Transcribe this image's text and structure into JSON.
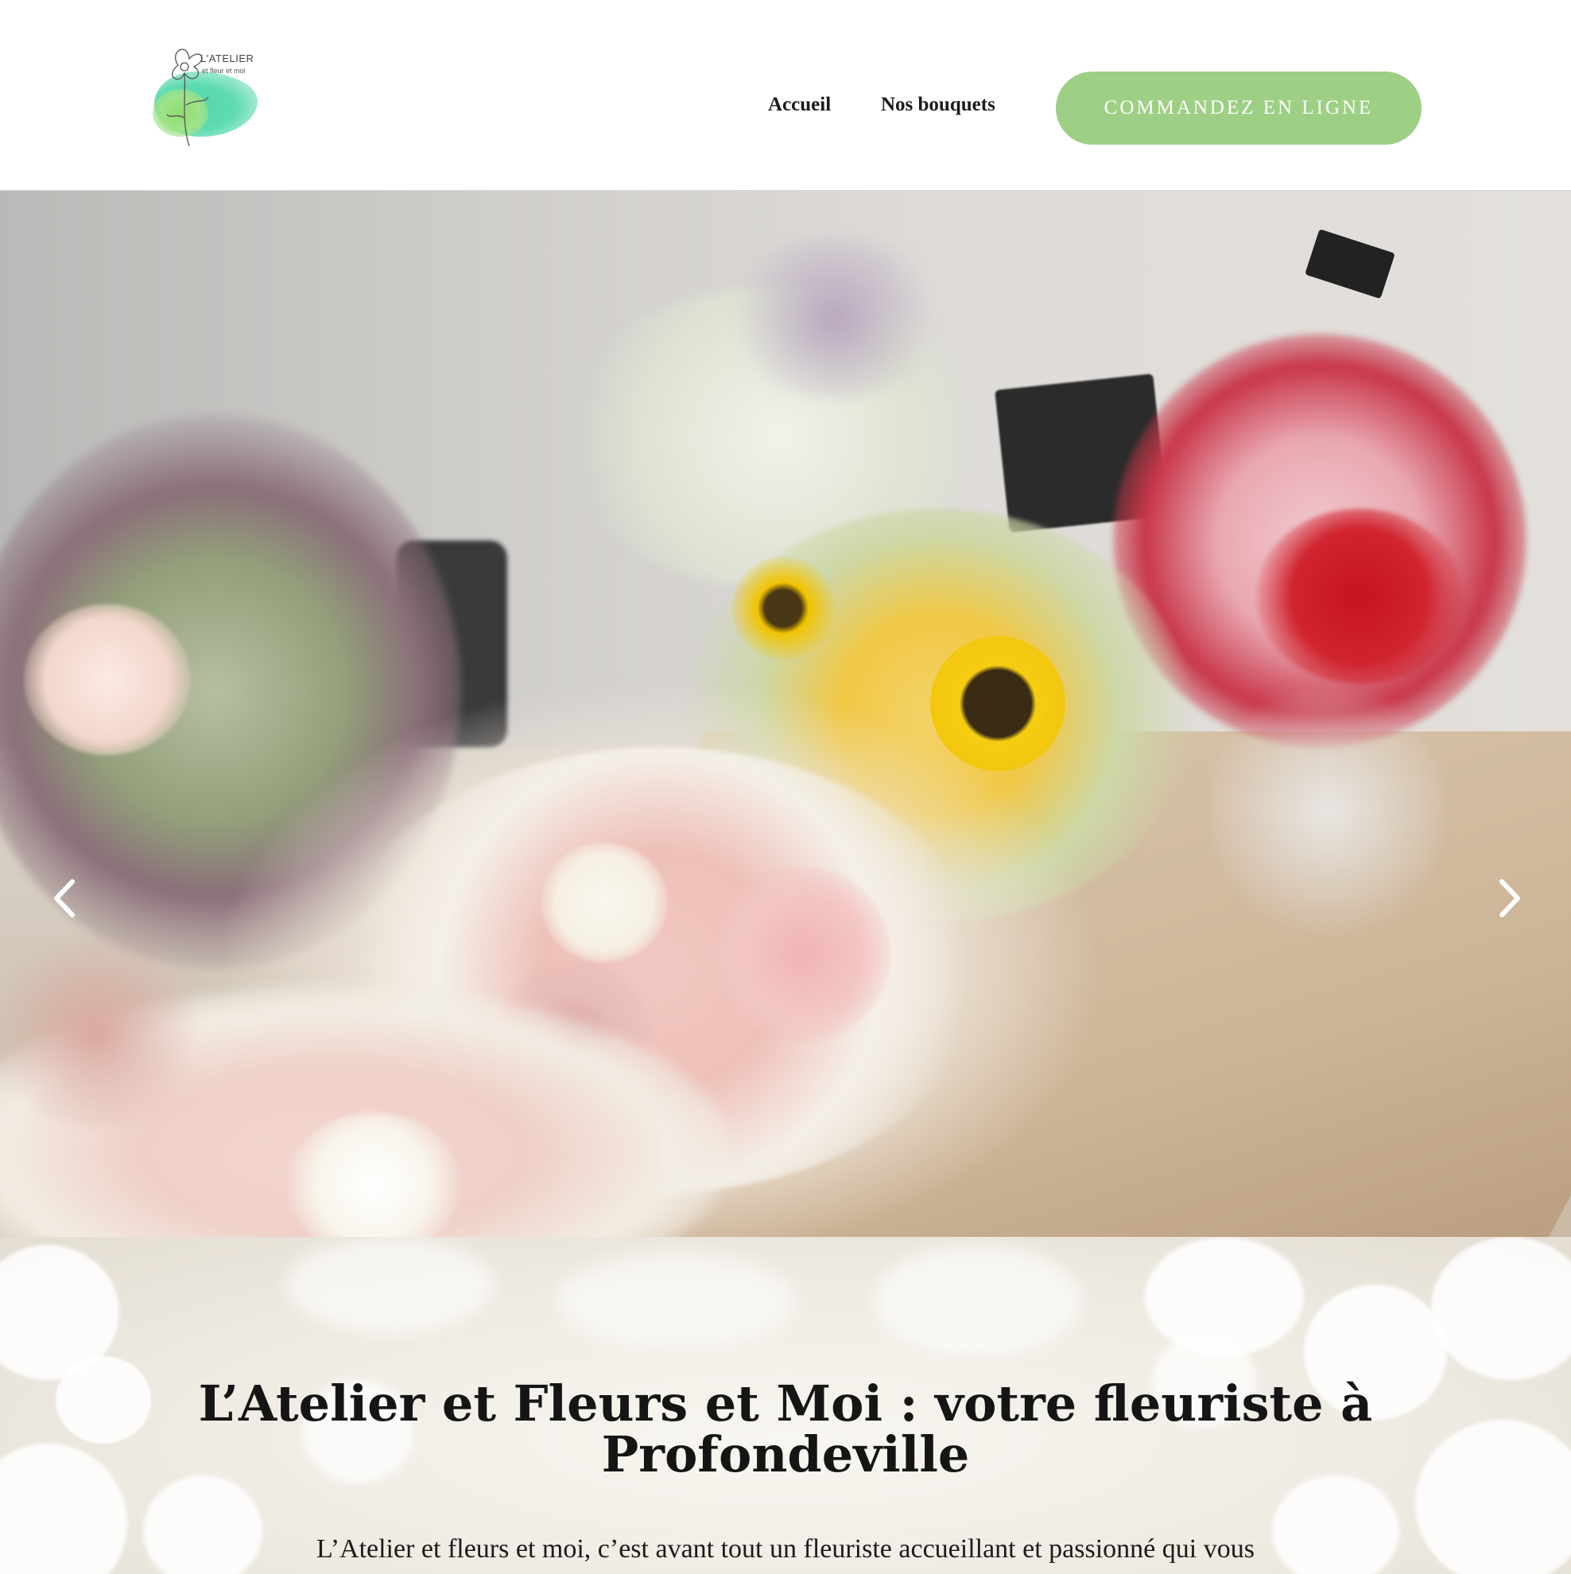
{
  "header": {
    "logo": {
      "title": "L'ATELIER",
      "subtitle": "et fleur et moi"
    },
    "nav": {
      "home_label": "Accueil",
      "bouquets_label": "Nos bouquets"
    },
    "cta_label": "COMMANDEZ EN LIGNE",
    "colors": {
      "cta_background": "#9dcf85",
      "cta_text": "#ffffff"
    }
  },
  "hero": {
    "slides_count": 3,
    "active_slide": 1,
    "prev_icon": "chevron-left-icon",
    "next_icon": "chevron-right-icon"
  },
  "intro": {
    "title_line1": "L’Atelier et Fleurs et Moi : votre fleuriste à",
    "title_line2": "Profondeville",
    "text": "L’Atelier et fleurs et moi, c’est avant tout un fleuriste accueillant et passionné qui vous"
  }
}
